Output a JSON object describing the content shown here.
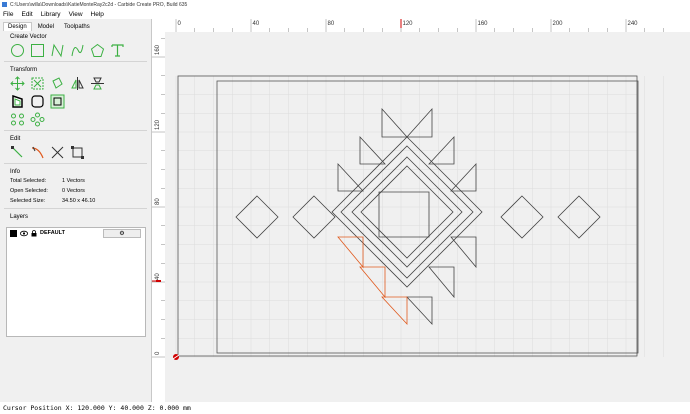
{
  "window": {
    "title": "C:\\Users\\willa\\Downloads\\KatieMonteRay2c2d - Carbide Create PRO, Build 635"
  },
  "menu": [
    "File",
    "Edit",
    "Library",
    "View",
    "Help"
  ],
  "tabs": [
    "Design",
    "Model",
    "Toolpaths"
  ],
  "sections": {
    "create_vector": "Create Vector",
    "transform": "Transform",
    "edit": "Edit",
    "info": "Info",
    "layers": "Layers"
  },
  "info": {
    "total_selected_label": "Total Selected:",
    "total_selected_value": "1 Vectors",
    "open_selected_label": "Open Selected:",
    "open_selected_value": "0 Vectors",
    "selected_size_label": "Selected Size:",
    "selected_size_value": "34.50 x 46.10"
  },
  "layers": [
    {
      "name": "DEFAULT",
      "color": "#000000"
    }
  ],
  "ruler": {
    "x_labels": [
      "0",
      "40",
      "80",
      "120",
      "160",
      "200",
      "240"
    ],
    "y_labels": [
      "160",
      "120",
      "80",
      "40",
      "0"
    ]
  },
  "status": {
    "cursor": "Cursor Position X: 120.000 Y: 40.000 Z: 0.000 mm"
  },
  "colors": {
    "accent": "#3cb043",
    "selection": "#e05a1e",
    "marker": "#d00000"
  }
}
